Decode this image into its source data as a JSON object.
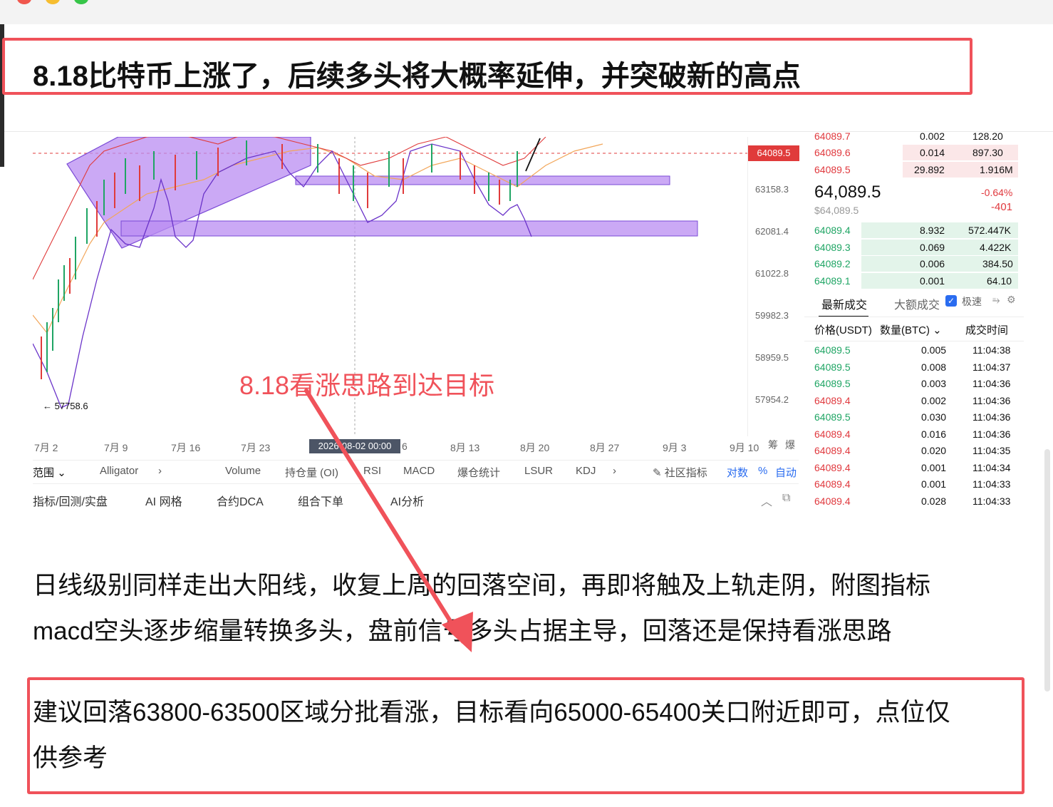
{
  "article": {
    "title": "8.18比特币上涨了，后续多头将大概率延伸，并突破新的高点",
    "paragraph1_line1": "日线级别同样走出大阳线，收复上周的回落空间，再即将触及上轨走阴，附图指标",
    "paragraph1_line2": "macd空头逐步缩量转换多头，盘前信号多头占据主导，回落还是保持看涨思路",
    "advice_line1": "建议回落63800-63500区域分批看涨，目标看向65000-65400关口附近即可，点位仅",
    "advice_line2": "供参考",
    "annotation": "8.18看涨思路到达目标"
  },
  "chart": {
    "current_price_tag": "64089.5",
    "y_ticks": [
      "63158.3",
      "62081.4",
      "61022.8",
      "59982.3",
      "58959.5",
      "57954.2"
    ],
    "low_label": "← 57758.6",
    "x_ticks": [
      "7月 2",
      "7月 9",
      "7月 16",
      "7月 23",
      "6",
      "8月 13",
      "8月 20",
      "8月 27",
      "9月 3",
      "9月 10"
    ],
    "crosshair_time": "2026-08-02 00:00",
    "corner_labels": [
      "筹",
      "爆"
    ]
  },
  "indicator_bar": {
    "range_label": "范围",
    "items": [
      "Alligator",
      "Volume",
      "持仓量 (OI)",
      "RSI",
      "MACD",
      "爆仓统计",
      "LSUR",
      "KDJ"
    ],
    "community": "社区指标",
    "log_label": "对数",
    "percent_label": "%",
    "auto_label": "自动"
  },
  "tools_bar": {
    "items": [
      "指标/回测/实盘",
      "AI 网格",
      "合约DCA",
      "组合下单",
      "AI分析"
    ]
  },
  "orderbook": {
    "asks": [
      {
        "price": "64089.7",
        "qty": "0.002",
        "total": "128.20"
      },
      {
        "price": "64089.6",
        "qty": "0.014",
        "total": "897.30"
      },
      {
        "price": "64089.5",
        "qty": "29.892",
        "total": "1.916M"
      }
    ],
    "mid_price": "64,089.5",
    "mid_usd": "$64,089.5",
    "change_pct": "-0.64%",
    "change_abs": "-401",
    "bids": [
      {
        "price": "64089.4",
        "qty": "8.932",
        "total": "572.447K"
      },
      {
        "price": "64089.3",
        "qty": "0.069",
        "total": "4.422K"
      },
      {
        "price": "64089.2",
        "qty": "0.006",
        "total": "384.50"
      },
      {
        "price": "64089.1",
        "qty": "0.001",
        "total": "64.10"
      }
    ],
    "tab_latest": "最新成交",
    "tab_large": "大额成交",
    "fast_label": "极速",
    "col_price": "价格(USDT)",
    "col_qty": "数量(BTC)",
    "col_time": "成交时间",
    "trades": [
      {
        "price": "64089.5",
        "qty": "0.005",
        "time": "11:04:38",
        "side": "buy"
      },
      {
        "price": "64089.5",
        "qty": "0.008",
        "time": "11:04:37",
        "side": "buy"
      },
      {
        "price": "64089.5",
        "qty": "0.003",
        "time": "11:04:36",
        "side": "buy"
      },
      {
        "price": "64089.4",
        "qty": "0.002",
        "time": "11:04:36",
        "side": "sell"
      },
      {
        "price": "64089.5",
        "qty": "0.030",
        "time": "11:04:36",
        "side": "buy"
      },
      {
        "price": "64089.4",
        "qty": "0.016",
        "time": "11:04:36",
        "side": "sell"
      },
      {
        "price": "64089.4",
        "qty": "0.020",
        "time": "11:04:35",
        "side": "sell"
      },
      {
        "price": "64089.4",
        "qty": "0.001",
        "time": "11:04:34",
        "side": "sell"
      },
      {
        "price": "64089.4",
        "qty": "0.001",
        "time": "11:04:33",
        "side": "sell"
      },
      {
        "price": "64089.4",
        "qty": "0.028",
        "time": "11:04:33",
        "side": "sell"
      }
    ]
  },
  "colors": {
    "highlight_red": "#f0525a",
    "bid_green": "#1fa564",
    "ask_red": "#e0393e",
    "zone_purple": "#b98cf2"
  }
}
